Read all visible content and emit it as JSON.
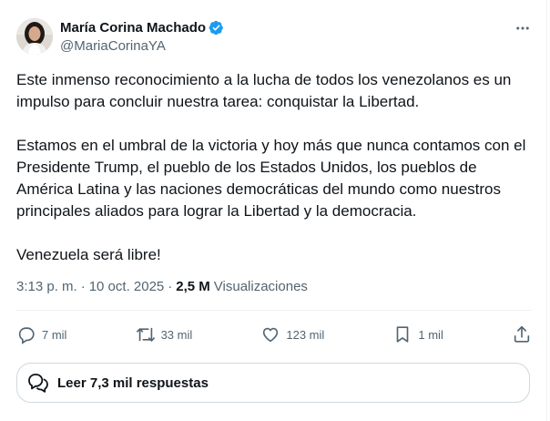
{
  "author": {
    "name": "María Corina Machado",
    "handle": "@MariaCorinaYA"
  },
  "tweet": {
    "text": "Este inmenso reconocimiento a la lucha de todos los venezolanos es un impulso para concluir nuestra tarea: conquistar la Libertad.\n\nEstamos en el umbral de la victoria y hoy más que nunca contamos con el Presidente Trump, el pueblo de los Estados Unidos, los pueblos de América Latina y las naciones democráticas del mundo como nuestros principales aliados para lograr la Libertad y la democracia.\n\nVenezuela será libre!",
    "time": "3:13 p. m.",
    "separator": "·",
    "date": "10 oct. 2025",
    "views_count": "2,5 M",
    "views_label": "Visualizaciones"
  },
  "actions": {
    "replies": "7 mil",
    "reposts": "33 mil",
    "likes": "123 mil",
    "bookmarks": "1 mil"
  },
  "replies_button": {
    "label": "Leer 7,3 mil respuestas"
  },
  "colors": {
    "text": "#0f1419",
    "muted": "#536471",
    "verified": "#1d9bf0",
    "border": "#cfd9de"
  },
  "icons": [
    "verified-badge-icon",
    "more-icon",
    "reply-icon",
    "repost-icon",
    "like-icon",
    "bookmark-icon",
    "share-icon",
    "conversation-icon"
  ]
}
